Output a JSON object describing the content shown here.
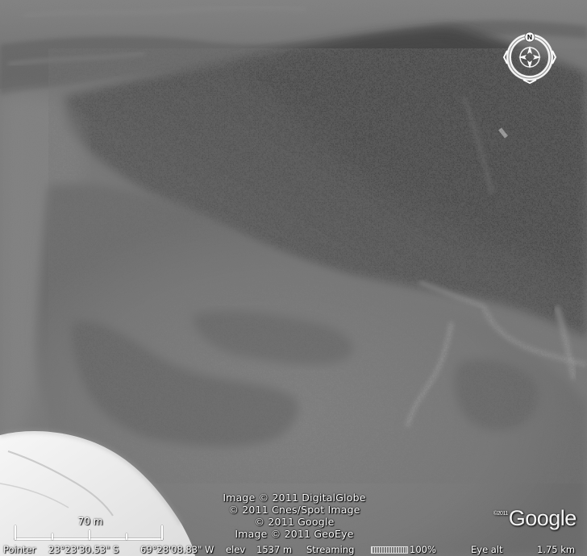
{
  "map": {
    "imagery_credits": [
      "Image © 2011 DigitalGlobe",
      "© 2011 Cnes/Spot Image",
      "© 2011 Google",
      "Image © 2011 GeoEye"
    ],
    "logo": {
      "super": "©2011",
      "text": "Google"
    },
    "scale": {
      "label": "70 m"
    },
    "compass": {
      "north_label": "N",
      "icon": "compass-rose-icon"
    }
  },
  "status_bar": {
    "pointer_label": "Pointer",
    "latitude": "23°23'30.53\" S",
    "longitude": "69°28'08.83\" W",
    "elev_label": "elev",
    "elevation": "1537 m",
    "streaming_label": "Streaming",
    "streaming_percent": "100%",
    "streaming_fraction": 1.0,
    "eye_alt_label": "Eye alt",
    "eye_alt": "1.75 km"
  },
  "colors": {
    "terrain_dark": "#3a3a3a",
    "terrain_mid": "#7a7a7a",
    "terrain_light": "#9c9c9c",
    "snow": "#eeeeee",
    "overlay_text": "#ffffff"
  }
}
